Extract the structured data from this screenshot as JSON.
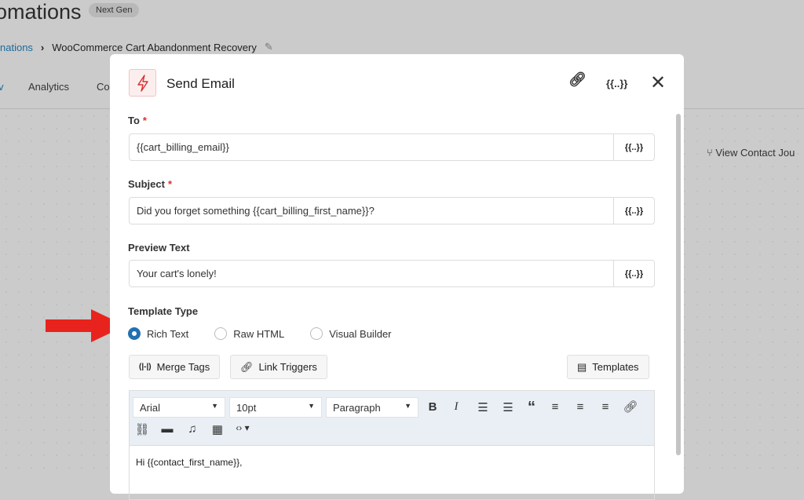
{
  "page": {
    "title": "omations",
    "badge": "Next Gen",
    "breadcrumb": {
      "parent": "nations",
      "current": "WooCommerce Cart Abandonment Recovery"
    },
    "tabs": [
      "v",
      "Analytics",
      "Co"
    ],
    "view_contact": "View Contact Jou"
  },
  "modal": {
    "title": "Send Email",
    "merge_icon_label": "{{..}}",
    "fields": [
      {
        "label": "To",
        "required": true,
        "value": "{{cart_billing_email}}"
      },
      {
        "label": "Subject",
        "required": true,
        "value": "Did you forget something {{cart_billing_first_name}}?"
      },
      {
        "label": "Preview Text",
        "required": false,
        "value": "Your cart's lonely!"
      }
    ],
    "template_type": {
      "label": "Template Type",
      "options": [
        "Rich Text",
        "Raw HTML",
        "Visual Builder"
      ],
      "selected": "Rich Text"
    },
    "buttons": {
      "merge_tags": "Merge Tags",
      "link_triggers": "Link Triggers",
      "templates": "Templates"
    },
    "editor": {
      "font": "Arial",
      "size": "10pt",
      "format": "Paragraph",
      "content": "Hi {{contact_first_name}},"
    }
  },
  "colors": {
    "accent": "#2271b1",
    "required": "#d9302f",
    "arrow": "#e8231d"
  }
}
